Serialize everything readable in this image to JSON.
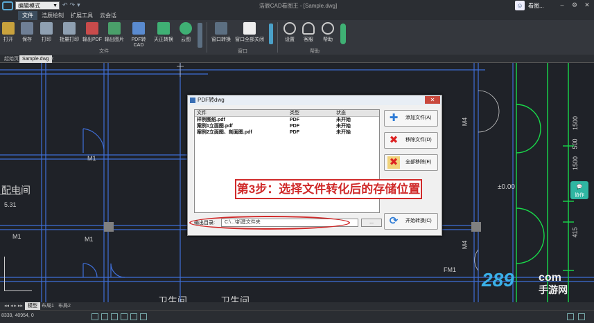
{
  "titlebar": {
    "mode": "编辑模式",
    "title": "浩辰CAD看图王 - [Sample.dwg]",
    "user": "看图..."
  },
  "ribbon_tabs": [
    "文件",
    "浩辰绘制",
    "扩展工具",
    "云会话"
  ],
  "ribbon": {
    "buttons": [
      {
        "label": "打开",
        "icon": "folder-open-icon"
      },
      {
        "label": "保存",
        "icon": "save-icon"
      },
      {
        "label": "打印",
        "icon": "printer-icon"
      },
      {
        "label": "批量打印",
        "icon": "batch-print-icon"
      },
      {
        "label": "输出PDF",
        "icon": "pdf-export-icon"
      },
      {
        "label": "输出图片",
        "icon": "image-export-icon"
      },
      {
        "label": "PDF转CAD",
        "icon": "pdf-to-cad-icon"
      },
      {
        "label": "天正转换",
        "icon": "convert-icon"
      },
      {
        "label": "云图",
        "icon": "cloud-icon"
      },
      {
        "label": "窗口转换",
        "icon": "window-switch-icon"
      },
      {
        "label": "窗口全部关闭",
        "icon": "window-close-all-icon"
      },
      {
        "label": "设置",
        "icon": "settings-icon"
      },
      {
        "label": "客服",
        "icon": "headset-icon"
      },
      {
        "label": "帮助",
        "icon": "help-icon"
      }
    ],
    "groups": [
      "文件",
      "窗口",
      "帮助"
    ]
  },
  "doc_tabs": [
    "起始页",
    "Sample.dwg"
  ],
  "drawing_labels": {
    "room1": "配电间",
    "dim1": "5.31",
    "m1a": "M1",
    "m1b": "M1",
    "m1c": "M1",
    "m4a": "M4",
    "m4b": "M4",
    "elev": "±0.00",
    "d1500a": "1500",
    "d500": "500",
    "d1500b": "1500",
    "d415": "415",
    "fm": "FM1",
    "room2": "卫生间",
    "room3": "卫生间"
  },
  "dialog": {
    "title": "PDF转dwg",
    "columns": [
      "文件",
      "类型",
      "状态"
    ],
    "rows": [
      {
        "file": "样例图纸.pdf",
        "type": "PDF",
        "status": "未开始"
      },
      {
        "file": "案例1立面图.pdf",
        "type": "PDF",
        "status": "未开始"
      },
      {
        "file": "案例2立面图、剖面图.pdf",
        "type": "PDF",
        "status": "未开始"
      }
    ],
    "add_btn": "添加文件(A)",
    "remove_btn": "移除文件(D)",
    "clear_btn": "全部移除(E)",
    "out_label": "输出目录:",
    "out_path": "C:\\...\\新建文件夹",
    "browse_btn": "...",
    "start_btn": "开始转换(C)"
  },
  "callout": "第3步：选择文件转化后的存储位置",
  "layout_tabs": [
    "模型",
    "布局1",
    "布局2"
  ],
  "status": {
    "coords": "8339, 40954, 0"
  },
  "chat_label": "协作",
  "watermark": {
    "num": "289",
    "com": "com",
    "cn": "手游网"
  },
  "colors": {
    "accent": "#3c4d5e",
    "cad_line": "#3f6fd8",
    "cad_green": "#19d84a",
    "highlight": "#d02a2a"
  }
}
